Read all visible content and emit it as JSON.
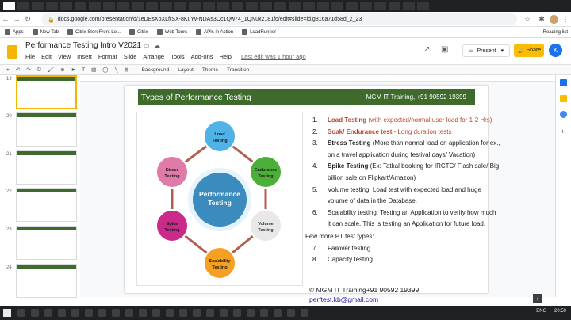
{
  "browser": {
    "url": "docs.google.com/presentation/d/1eDEsXoXLfrSX-8KuYv-NDAs3Oc1Qw74_1QNux2181fo/edit#slide=id.g816a71d58d_2_23",
    "bookmarks": [
      {
        "label": "Apps"
      },
      {
        "label": "New Tab"
      },
      {
        "label": "Citrix StoreFront Lo..."
      },
      {
        "label": "Citrix"
      },
      {
        "label": "Web Tours"
      },
      {
        "label": "APIs in Action"
      },
      {
        "label": "LoadRunner"
      }
    ],
    "reading_list": "Reading list"
  },
  "app": {
    "title": "Performance Testing Intro V2021",
    "menu": [
      "File",
      "Edit",
      "View",
      "Insert",
      "Format",
      "Slide",
      "Arrange",
      "Tools",
      "Add-ons",
      "Help"
    ],
    "last_edit": "Last edit was 1 hour ago",
    "present_label": "Present",
    "share_label": "Share",
    "avatar_letter": "K"
  },
  "toolbar": {
    "background": "Background",
    "layout": "Layout",
    "theme": "Theme",
    "transition": "Transition"
  },
  "filmstrip": [
    {
      "num": "19",
      "selected": true
    },
    {
      "num": "20",
      "selected": false
    },
    {
      "num": "21",
      "selected": false
    },
    {
      "num": "22",
      "selected": false
    },
    {
      "num": "23",
      "selected": false
    },
    {
      "num": "24",
      "selected": false
    }
  ],
  "slide": {
    "title": "Types of Performance Testing",
    "company": "MGM IT Training, +91 90592 19399",
    "diagram": {
      "center": "Performance Testing",
      "nodes": [
        {
          "label": "Load Testing",
          "color": "#4fb3e8"
        },
        {
          "label": "Endurance Testing",
          "color": "#4caf3a"
        },
        {
          "label": "Volume Testing",
          "color": "#e8e8e8"
        },
        {
          "label": "Scalability Testing",
          "color": "#f5a020"
        },
        {
          "label": "Spike Testing",
          "color": "#cc2a8a"
        },
        {
          "label": "Stress Testing",
          "color": "#e07aa8"
        }
      ]
    },
    "list": [
      {
        "n": "1.",
        "bold": "Load Testing",
        "rest": " (with expected/normal user load for 1-2 Hrs)",
        "style": "red"
      },
      {
        "n": "2.",
        "bold": "Soak/ Endurance test",
        "rest": " - Long duration tests",
        "style": "red"
      },
      {
        "n": "3.",
        "bold": "Stress Testing",
        "rest": " (More than normal load on application for ex., on a travel application during festival days/ Vacation)",
        "style": "normal"
      },
      {
        "n": "4.",
        "bold": "Spike Testing",
        "rest": " (Ex: Tatkal booking for IRCTC/ Flash sale/ Big billion sale on Flipkart/Amazon)",
        "style": "normal"
      },
      {
        "n": "5.",
        "bold": "",
        "rest": "Volume testing: Load test with expected load and huge volume of data in the Database.",
        "style": "normal"
      },
      {
        "n": "6.",
        "bold": "",
        "rest": "Scalability testing: Testing an Application to verify how much it can scale. This is testing an Application for future load.",
        "style": "normal"
      }
    ],
    "few_more": "Few more PT test types:",
    "extra": [
      {
        "n": "7.",
        "text": "Failover testing"
      },
      {
        "n": "8.",
        "text": "Capacity testing"
      }
    ],
    "footer_line": "©  MGM IT Training+91 90592 19399",
    "footer_email": "perftest.kb@gmail.com"
  },
  "taskbar": {
    "lang": "ENG",
    "time": "20:59"
  }
}
